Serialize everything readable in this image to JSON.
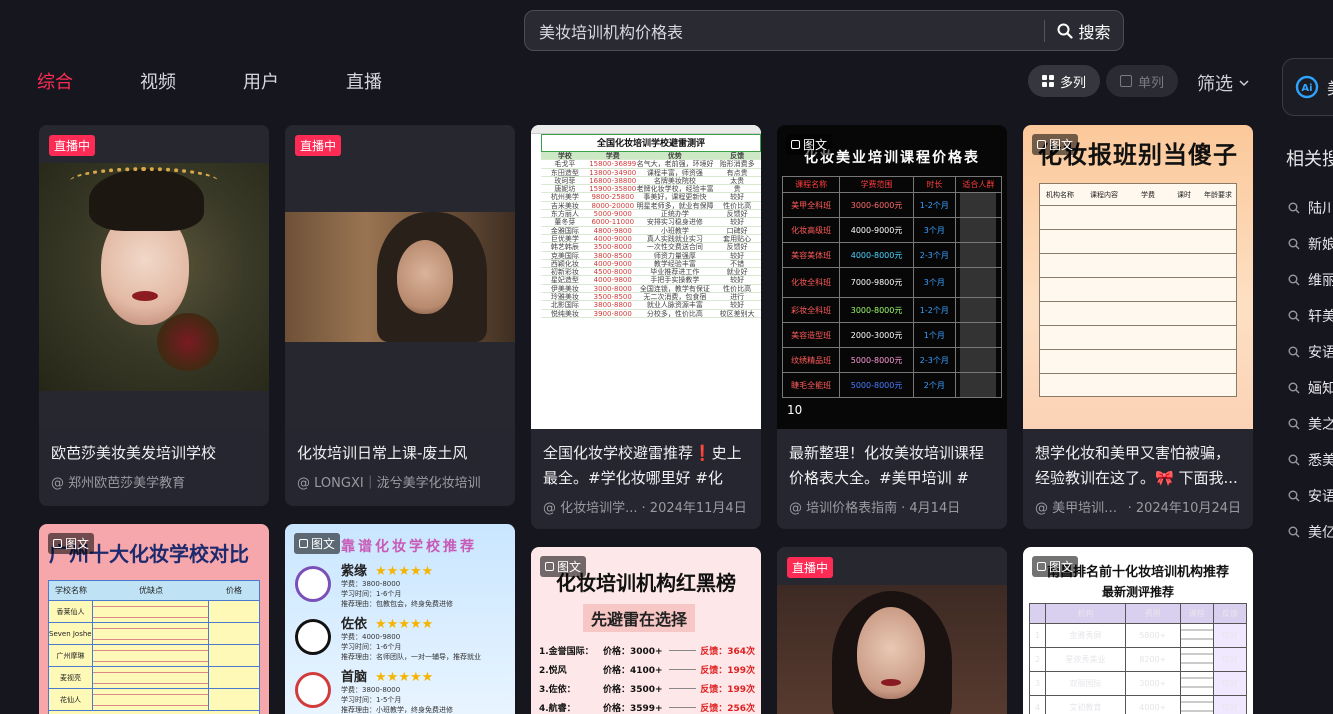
{
  "search": {
    "query": "美妆培训机构价格表",
    "button_label": "搜索"
  },
  "tabs": [
    {
      "label": "综合",
      "active": true
    },
    {
      "label": "视频",
      "active": false
    },
    {
      "label": "用户",
      "active": false
    },
    {
      "label": "直播",
      "active": false
    }
  ],
  "view": {
    "multi_label": "多列",
    "single_label": "单列",
    "filter_label": "筛选"
  },
  "right_panel": {
    "ai_label": "美",
    "related_title": "相关搜",
    "related": [
      "陆川",
      "新娘",
      "维丽",
      "轩美",
      "安语",
      "婳知",
      "美之",
      "悉美",
      "安语",
      "美亿"
    ]
  },
  "badges": {
    "live": "直播中",
    "pic": "图文"
  },
  "cards": [
    {
      "title": "欧芭莎美妆美发培训学校",
      "author": "@ 郑州欧芭莎美学教育",
      "date": ""
    },
    {
      "title": "化妆培训日常上课-废土风",
      "author": "@ LONGXI｜泷兮美学化妆培训",
      "date": ""
    },
    {
      "title": "全国化妆学校避雷推荐❗️史上最全。#学化妆哪里好 #化妆...",
      "author": "@ 化妆培训学...",
      "date": "· 2024年11月4日"
    },
    {
      "title": "最新整理！化妆美妆培训课程价格表大全。#美甲培训 #美...",
      "author": "@ 培训价格表指南",
      "date": "· 4月14日"
    },
    {
      "title": "想学化妆和美甲又害怕被骗，经验教训在这了。🎀 下面我...",
      "author": "@ 美甲培训机...",
      "date": "· 2024年10月24日"
    }
  ],
  "thumb_text": {
    "c3_title": "全国化妆培训学校避雷测评",
    "c3_headers": [
      "学校",
      "学费",
      "优势",
      "反馈"
    ],
    "c3_rows": [
      [
        "毛戈平",
        "15800-36899",
        "名气大，老前强，环境好",
        "贻形消费多"
      ],
      [
        "东田造型",
        "13800-34900",
        "课程丰富，师资强",
        "有点贵"
      ],
      [
        "玫珂菲",
        "16800-38800",
        "名牌美妆院校",
        "太贵"
      ],
      [
        "唐妮坊",
        "15900-35800",
        "老牌化妆学校，经验丰富",
        "贵"
      ],
      [
        "杭州美学",
        "9800-25800",
        "事美好，课程更新快",
        "较好"
      ],
      [
        "吉米美妆",
        "8000-20000",
        "明星老师多，就业有保障",
        "性价比高"
      ],
      [
        "东方丽人",
        "5000-9000",
        "正统办学",
        "反馈好"
      ],
      [
        "董冬芽",
        "6000-11000",
        "安排实习稳身进修",
        "较好"
      ],
      [
        "金雅国际",
        "4800-9800",
        "小班教学",
        "口碑好"
      ],
      [
        "巨优美学",
        "4000-9000",
        "真人实践就业实习",
        "套用贴心"
      ],
      [
        "韩艺韩辰",
        "3500-8000",
        "一次性交费送合同",
        "反馈好"
      ],
      [
        "克美国际",
        "3800-8500",
        "师资力量强厚",
        "较好"
      ],
      [
        "西颖化妆",
        "4000-9000",
        "教学经验丰富",
        "不错"
      ],
      [
        "初新彩妆",
        "4500-8000",
        "毕业推荐进工作",
        "就业好"
      ],
      [
        "星妃造型",
        "4000-9800",
        "手把手实操教学",
        "较好"
      ],
      [
        "伊美美妆",
        "3000-8000",
        "全国连锁，教学有保证",
        "性价比高"
      ],
      [
        "玲雅美妆",
        "3500-8500",
        "无二次消费，包食宿",
        "进行"
      ],
      [
        "北影国际",
        "3800-8800",
        "就业人脉资源丰富",
        "较好"
      ],
      [
        "悦纯美妆",
        "3900-8000",
        "分校多，性价比高",
        "校区差别大"
      ]
    ],
    "c4_title": "化妆美业培训课程价格表",
    "c4_headers": [
      "课程名称",
      "学费范围",
      "时长",
      "适合人群"
    ],
    "c4_rows": [
      [
        "美甲全科班",
        "3000-6000元",
        "1-2个月"
      ],
      [
        "化妆高级班",
        "4000-9000元",
        "3个月"
      ],
      [
        "美容美体班",
        "4000-8000元",
        "2-3个月"
      ],
      [
        "化妆全科班",
        "7000-9800元",
        "3个月"
      ],
      [
        "彩妆全科班",
        "3000-8000元",
        "1-2个月"
      ],
      [
        "美容造型班",
        "2000-3000元",
        "1个月"
      ],
      [
        "纹绣精品班",
        "5000-8000元",
        "2-3个月"
      ],
      [
        "睫毛全能班",
        "5000-8000元",
        "2个月"
      ]
    ],
    "c4_footer": "10",
    "c5_title": "化妆报班别当傻子",
    "c5_headers": [
      "机构名称",
      "课程内容",
      "学费",
      "课时",
      "年龄要求"
    ],
    "c6_title": "广州十大化妆学校对比",
    "c6_headers": [
      "学校名称",
      "优缺点",
      "价格"
    ],
    "c6_rows": [
      "香莱仙人",
      "Seven Joshen",
      "广州摩琳",
      "麦视亮",
      "花仙人"
    ],
    "c7_title": "靠谱化妆学校推荐",
    "c7_items": [
      {
        "name": "紫缘",
        "lines": [
          "学费：3800-8000",
          "学习时间：1-6个月",
          "推荐理由：包教包会，终身免费进修"
        ]
      },
      {
        "name": "佐依",
        "lines": [
          "学费：4000-9800",
          "学习时间：1-6个月",
          "推荐理由：名师团队，一对一辅导，推荐就业"
        ]
      },
      {
        "name": "首脑",
        "lines": [
          "学费：3800-8000",
          "学习时间：1-5个月",
          "推荐理由：小班教学，终身免费进修"
        ]
      }
    ],
    "c8_title": "化妆培训机构红黑榜",
    "c8_subtitle": "先避雷在选择",
    "c8_rows": [
      {
        "name": "1.金誉国际：",
        "price": "价格：3000+",
        "fb": "反馈：364次"
      },
      {
        "name": "2.悦风",
        "price": "价格：4100+",
        "fb": "反馈：199次"
      },
      {
        "name": "3.佐依：",
        "price": "价格：3500+",
        "fb": "反馈：199次"
      },
      {
        "name": "4.航睿：",
        "price": "价格：3599+",
        "fb": "反馈：256次"
      }
    ],
    "c10_title": "南昌排名前十化妆培训机构推荐",
    "c10_subtitle": "最新测评推荐",
    "c10_headers": [
      "机构",
      "费用",
      "课程",
      "反馈"
    ],
    "c10_rows": [
      [
        "1",
        "金雅秀屏",
        "5800+",
        "较好"
      ],
      [
        "2",
        "星依秀美业",
        "8200+",
        "较好"
      ],
      [
        "3",
        "双丽国际",
        "3000+",
        "较好"
      ],
      [
        "4",
        "艾初教育",
        "4000+",
        "较好"
      ]
    ]
  },
  "colors": {
    "accent": "#fe2c55",
    "background": "#16161e",
    "card": "#262630"
  }
}
